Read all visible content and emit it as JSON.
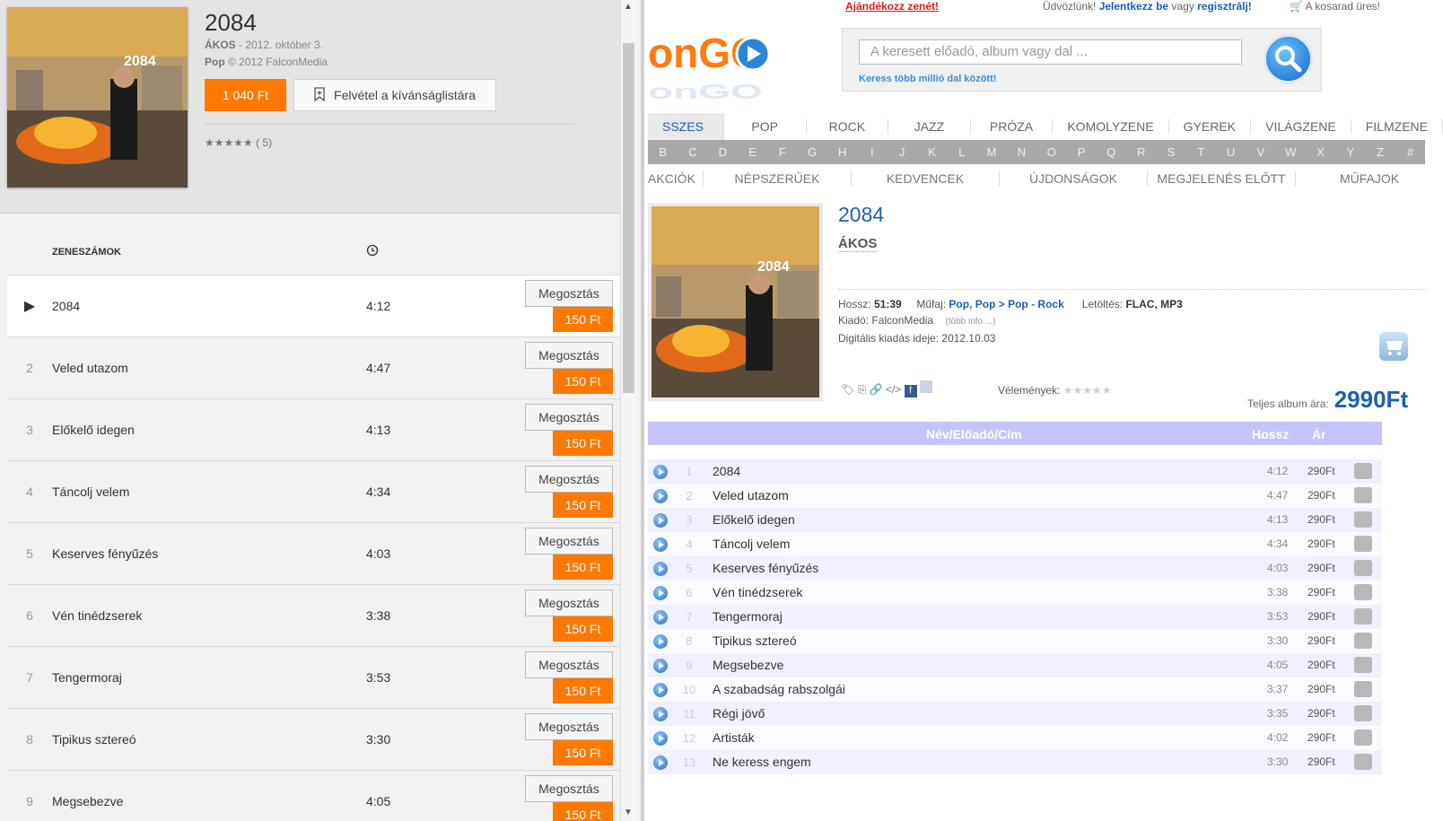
{
  "left": {
    "album_title": "2084",
    "artist": "ÁKOS",
    "release_info": " - 2012. október 3.",
    "genre": "Pop",
    "copyright": " © 2012 FalconMedia",
    "buy_price": "1 040 Ft",
    "wishlist_label": "Felvétel a kívánságlistára",
    "rating_stars": "★★★★★",
    "rating_count": "( 5)",
    "tracks_header": "ZENESZÁMOK",
    "share_label": "Megosztás",
    "track_price": "150 Ft",
    "tracks": [
      {
        "num": "▶",
        "name": "2084",
        "dur": "4:12"
      },
      {
        "num": "2",
        "name": "Veled utazom",
        "dur": "4:47"
      },
      {
        "num": "3",
        "name": "Előkelő idegen",
        "dur": "4:13"
      },
      {
        "num": "4",
        "name": "Táncolj velem",
        "dur": "4:34"
      },
      {
        "num": "5",
        "name": "Keserves fényűzés",
        "dur": "4:03"
      },
      {
        "num": "6",
        "name": "Vén tinédzserek",
        "dur": "3:38"
      },
      {
        "num": "7",
        "name": "Tengermoraj",
        "dur": "3:53"
      },
      {
        "num": "8",
        "name": "Tipikus sztereó",
        "dur": "3:30"
      },
      {
        "num": "9",
        "name": "Megsebezve",
        "dur": "4:05"
      }
    ]
  },
  "right": {
    "gift": "Ajándékozz zenét!",
    "welcome": "Üdvözlünk! ",
    "login": "Jelentkezz be",
    "or": " vagy ",
    "register": "regisztrálj!",
    "cart": "A kosarad üres!",
    "logo_text": "onGO",
    "search_placeholder": "A keresett előadó, album vagy dal ...",
    "search_hint": "Keress több millió dal között!",
    "nav_genres": [
      "SSZES",
      "POP",
      "ROCK",
      "JAZZ",
      "PRÓZA",
      "KOMOLYZENE",
      "GYEREK",
      "VILÁGZENE",
      "FILMZENE"
    ],
    "nav_letters": [
      "B",
      "C",
      "D",
      "E",
      "F",
      "G",
      "H",
      "I",
      "J",
      "K",
      "L",
      "M",
      "N",
      "O",
      "P",
      "Q",
      "R",
      "S",
      "T",
      "U",
      "V",
      "W",
      "X",
      "Y",
      "Z",
      "#"
    ],
    "nav_sections": [
      "AKCIÓK",
      "NÉPSZERŰEK",
      "KEDVENCEK",
      "ÚJDONSÁGOK",
      "MEGJELENÉS ELŐTT",
      "MŰFAJOK"
    ],
    "album_title": "2084",
    "artist": "ÁKOS",
    "length_label": "Hossz: ",
    "length": "51:39",
    "genre_label": "Műfaj: ",
    "genre": "Pop, Pop > Pop - Rock",
    "download_label": "Letöltés: ",
    "download": "FLAC, MP3",
    "label_label": "Kiadó: FalconMedia",
    "more_info": "(több info ...)",
    "release_date": "Digitális kiadás ideje: 2012.10.03",
    "reviews_label": "Vélemények:",
    "reviews_stars": "★★★★★",
    "total_label": "Teljes album ára:",
    "total_price": "2990Ft",
    "col_name": "Név/Előadó/Cím",
    "col_length": "Hossz",
    "col_price": "Ár",
    "tracks": [
      {
        "num": "1",
        "name": "2084",
        "dur": "4:12",
        "price": "290Ft"
      },
      {
        "num": "2",
        "name": "Veled utazom",
        "dur": "4:47",
        "price": "290Ft"
      },
      {
        "num": "3",
        "name": "Előkelő idegen",
        "dur": "4:13",
        "price": "290Ft"
      },
      {
        "num": "4",
        "name": "Táncolj velem",
        "dur": "4:34",
        "price": "290Ft"
      },
      {
        "num": "5",
        "name": "Keserves fényűzés",
        "dur": "4:03",
        "price": "290Ft"
      },
      {
        "num": "6",
        "name": "Vén tinédzserek",
        "dur": "3:38",
        "price": "290Ft"
      },
      {
        "num": "7",
        "name": "Tengermoraj",
        "dur": "3:53",
        "price": "290Ft"
      },
      {
        "num": "8",
        "name": "Tipikus sztereó",
        "dur": "3:30",
        "price": "290Ft"
      },
      {
        "num": "9",
        "name": "Megsebezve",
        "dur": "4:05",
        "price": "290Ft"
      },
      {
        "num": "10",
        "name": "A szabadság rabszolgái",
        "dur": "3:37",
        "price": "290Ft"
      },
      {
        "num": "11",
        "name": "Régi jövő",
        "dur": "3:35",
        "price": "290Ft"
      },
      {
        "num": "12",
        "name": "Artisták",
        "dur": "4:02",
        "price": "290Ft"
      },
      {
        "num": "13",
        "name": "Ne keress engem",
        "dur": "3:30",
        "price": "290Ft"
      }
    ]
  },
  "colors": {
    "accent_orange": "#ff7800",
    "link_blue": "#1d5fb6",
    "table_header": "#c6c3ff"
  }
}
